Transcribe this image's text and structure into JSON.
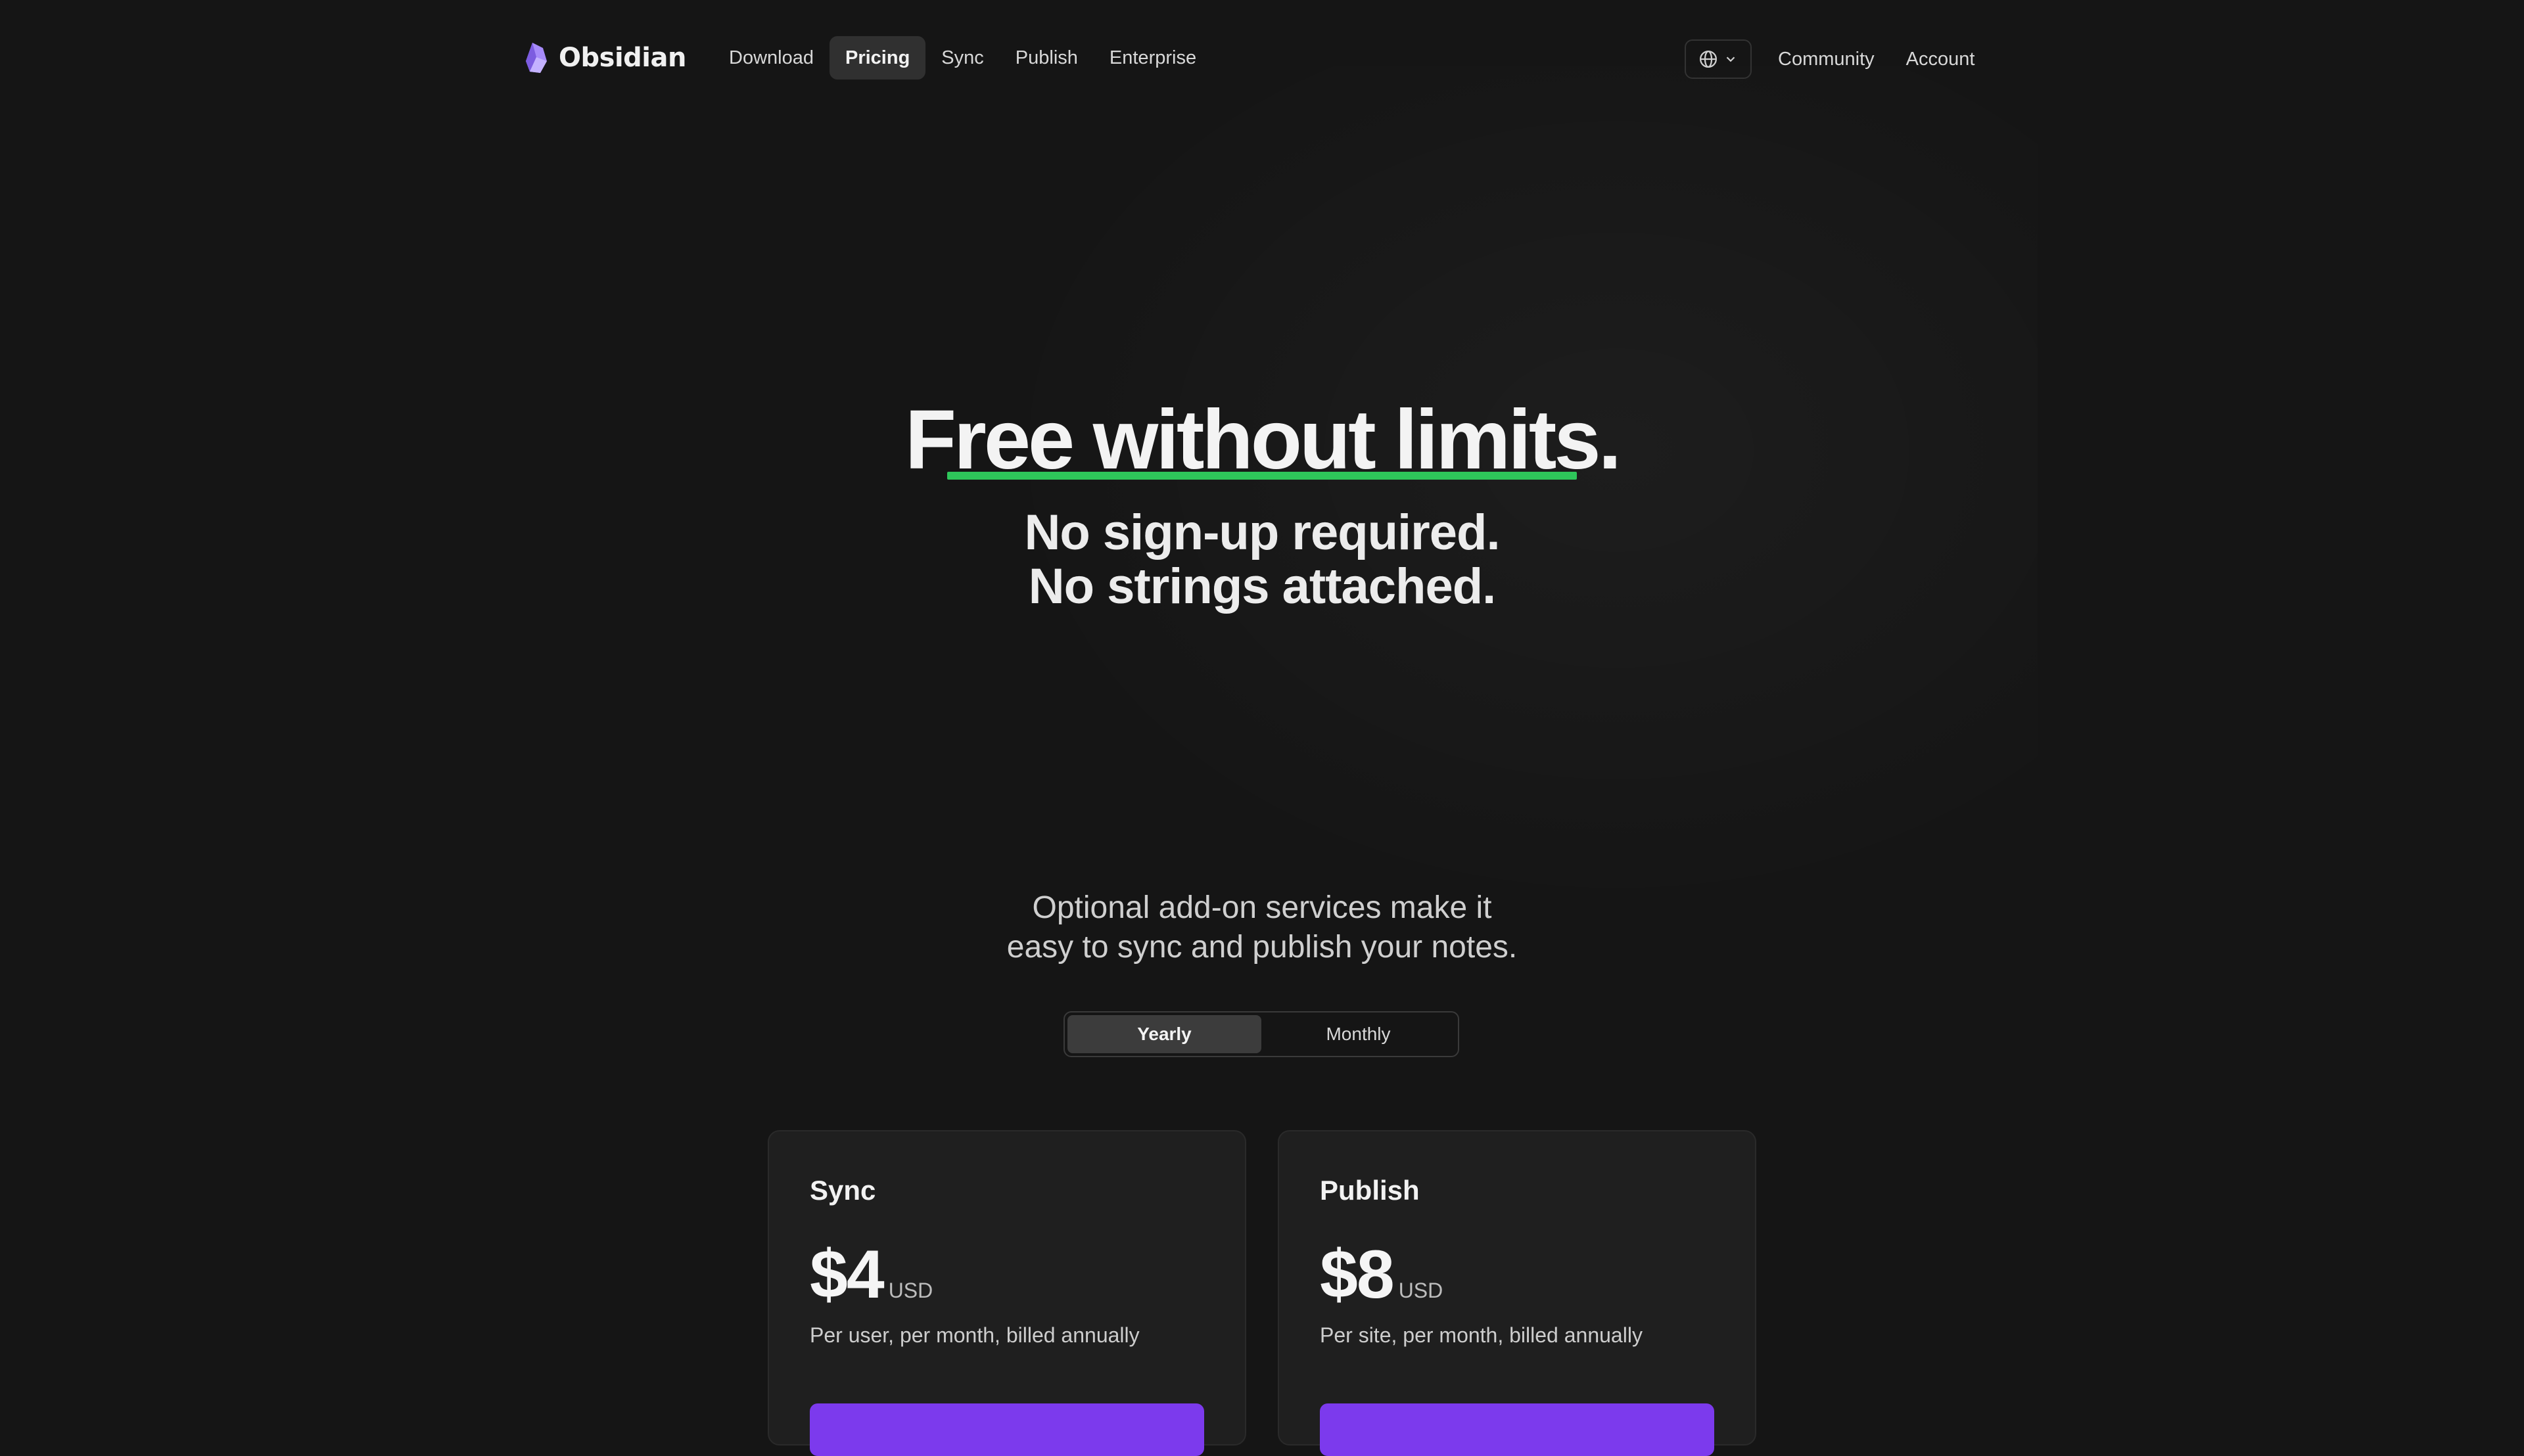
{
  "nav": {
    "brand": "Obsidian",
    "links": [
      {
        "label": "Download",
        "active": false
      },
      {
        "label": "Pricing",
        "active": true
      },
      {
        "label": "Sync",
        "active": false
      },
      {
        "label": "Publish",
        "active": false
      },
      {
        "label": "Enterprise",
        "active": false
      }
    ],
    "language_icon": "globe-icon",
    "right_links": [
      {
        "label": "Community"
      },
      {
        "label": "Account"
      }
    ]
  },
  "hero": {
    "title": "Free without limits.",
    "subtitle_line1": "No sign-up required.",
    "subtitle_line2": "No strings attached."
  },
  "addons": {
    "line1": "Optional add-on services make it",
    "line2": "easy to sync and publish your notes."
  },
  "billing_toggle": {
    "options": [
      "Yearly",
      "Monthly"
    ],
    "selected": "Yearly"
  },
  "plans": [
    {
      "name": "Sync",
      "price": "$4",
      "currency": "USD",
      "description": "Per user, per month, billed annually"
    },
    {
      "name": "Publish",
      "price": "$8",
      "currency": "USD",
      "description": "Per site, per month, billed annually"
    }
  ],
  "colors": {
    "background": "#151515",
    "accent_purple": "#7c3aed",
    "underline_green": "#2ec65a",
    "logo_purple": "#a78bfa"
  }
}
